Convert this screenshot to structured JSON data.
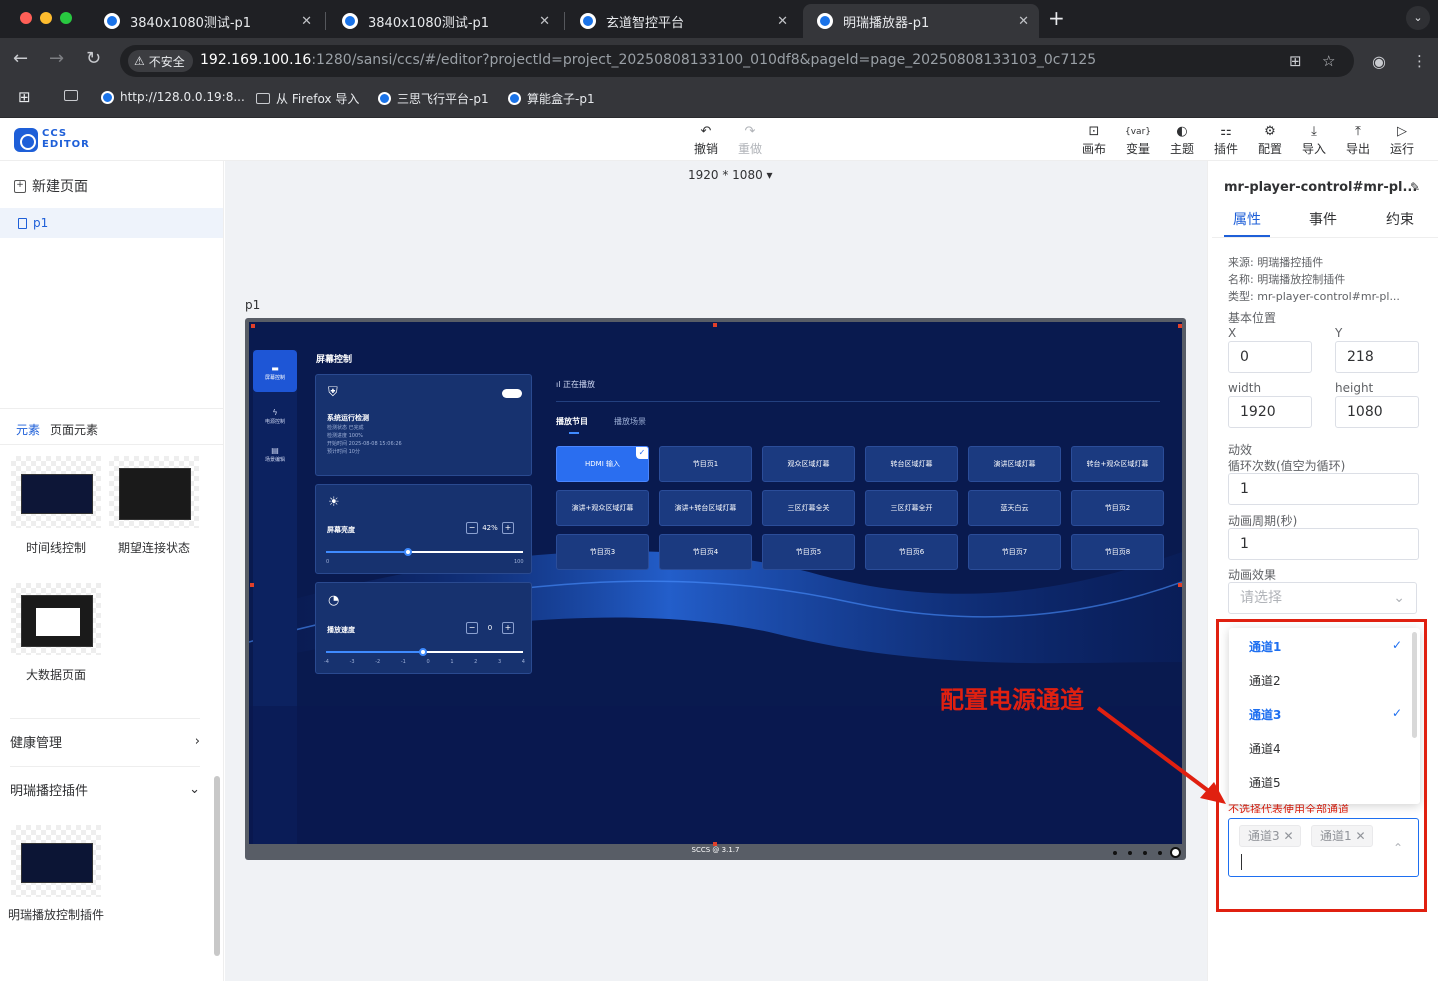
{
  "browser": {
    "tabs": [
      {
        "title": "3840x1080测试-p1"
      },
      {
        "title": "3840x1080测试-p1"
      },
      {
        "title": "玄道智控平台"
      },
      {
        "title": "明瑞播放器-p1"
      }
    ],
    "new_tab": "+",
    "tab_menu": "⌄",
    "security_label": "不安全",
    "url_host": "192.169.100.16",
    "url_rest": ":1280/sansi/ccs/#/editor?projectId=project_20250808133100_010df8&pageId=page_20250808133103_0c7125",
    "bookmarks": [
      "http://128.0.0.19:8...",
      "从 Firefox 导入",
      "三思飞行平台-p1",
      "算能盒子-p1"
    ]
  },
  "app": {
    "logo_line1": "CCS",
    "logo_line2": "EDITOR",
    "undo": "撤销",
    "redo": "重做",
    "toolbar": [
      {
        "label": "画布",
        "icon": "⊡"
      },
      {
        "label": "变量",
        "icon": "{var}"
      },
      {
        "label": "主题",
        "icon": "◐"
      },
      {
        "label": "插件",
        "icon": "⚏"
      },
      {
        "label": "配置",
        "icon": "⚙"
      },
      {
        "label": "导入",
        "icon": "⤓"
      },
      {
        "label": "导出",
        "icon": "⤒"
      },
      {
        "label": "运行",
        "icon": "▷"
      }
    ]
  },
  "left": {
    "new_page": "新建页面",
    "page_name": "p1",
    "tab_elements": "元素",
    "tab_page_elements": "页面元素",
    "cards": [
      "时间线控制",
      "期望连接状态",
      "大数据页面"
    ],
    "section_health": "健康管理",
    "section_plugin": "明瑞播控插件",
    "plugin_card": "明瑞播放控制插件"
  },
  "canvas": {
    "size": "1920 * 1080",
    "page_label": "p1",
    "screen": {
      "side_nav": [
        "屏幕控制",
        "电源控制",
        "场景编辑"
      ],
      "title": "屏幕控制",
      "panel1_title": "系统运行检测",
      "panel1_lines": [
        "检测状态 已完成",
        "检测进度 100%",
        "开始时间 2025-08-08 15:06:26",
        "预计时间 10分"
      ],
      "panel2_title": "屏幕亮度",
      "brightness_value": "42%",
      "brightness_min": "0",
      "brightness_max": "100",
      "brightness_level": 0.42,
      "panel3_title": "播放速度",
      "speed_value": "0",
      "speed_ticks": [
        "-4",
        "-3",
        "-2",
        "-1",
        "0",
        "1",
        "2",
        "3",
        "4"
      ],
      "now_playing": "正在播放",
      "tab_programs": "播放节目",
      "tab_scenes": "播放场景",
      "buttons": [
        "HDMI 输入",
        "节目页1",
        "观众区域灯幕",
        "转台区域灯幕",
        "演讲区域灯幕",
        "转台+观众区域灯幕",
        "演讲+观众区域灯幕",
        "演讲+转台区域灯幕",
        "三区灯幕全关",
        "三区灯幕全开",
        "蓝天白云",
        "节目页2",
        "节目页3",
        "节目页4",
        "节目页5",
        "节目页6",
        "节目页7",
        "节目页8"
      ],
      "footer": "SCCS @ 3.1.7"
    }
  },
  "right": {
    "component_title": "mr-player-control#mr-pl...",
    "tabs": [
      "属性",
      "事件",
      "约束"
    ],
    "source": "来源: 明瑞播控插件",
    "name": "名称: 明瑞播放控制插件",
    "type": "类型: mr-player-control#mr-pl...",
    "basic_position": "基本位置",
    "x_label": "X",
    "x_value": "0",
    "y_label": "Y",
    "y_value": "218",
    "width_label": "width",
    "width_value": "1920",
    "height_label": "height",
    "height_value": "1080",
    "anim_label": "动效",
    "loop_label": "循环次数(值空为循环)",
    "loop_value": "1",
    "period_label": "动画周期(秒)",
    "period_value": "1",
    "effect_label": "动画效果",
    "effect_placeholder": "请选择",
    "dropdown": [
      {
        "label": "通道1",
        "selected": true
      },
      {
        "label": "通道2",
        "selected": false
      },
      {
        "label": "通道3",
        "selected": true
      },
      {
        "label": "通道4",
        "selected": false
      },
      {
        "label": "通道5",
        "selected": false
      }
    ],
    "hint": "不选择代表使用全部通道",
    "tags": [
      "通道3",
      "通道1"
    ]
  },
  "annotation": {
    "text": "配置电源通道",
    "color": "#e02010"
  }
}
